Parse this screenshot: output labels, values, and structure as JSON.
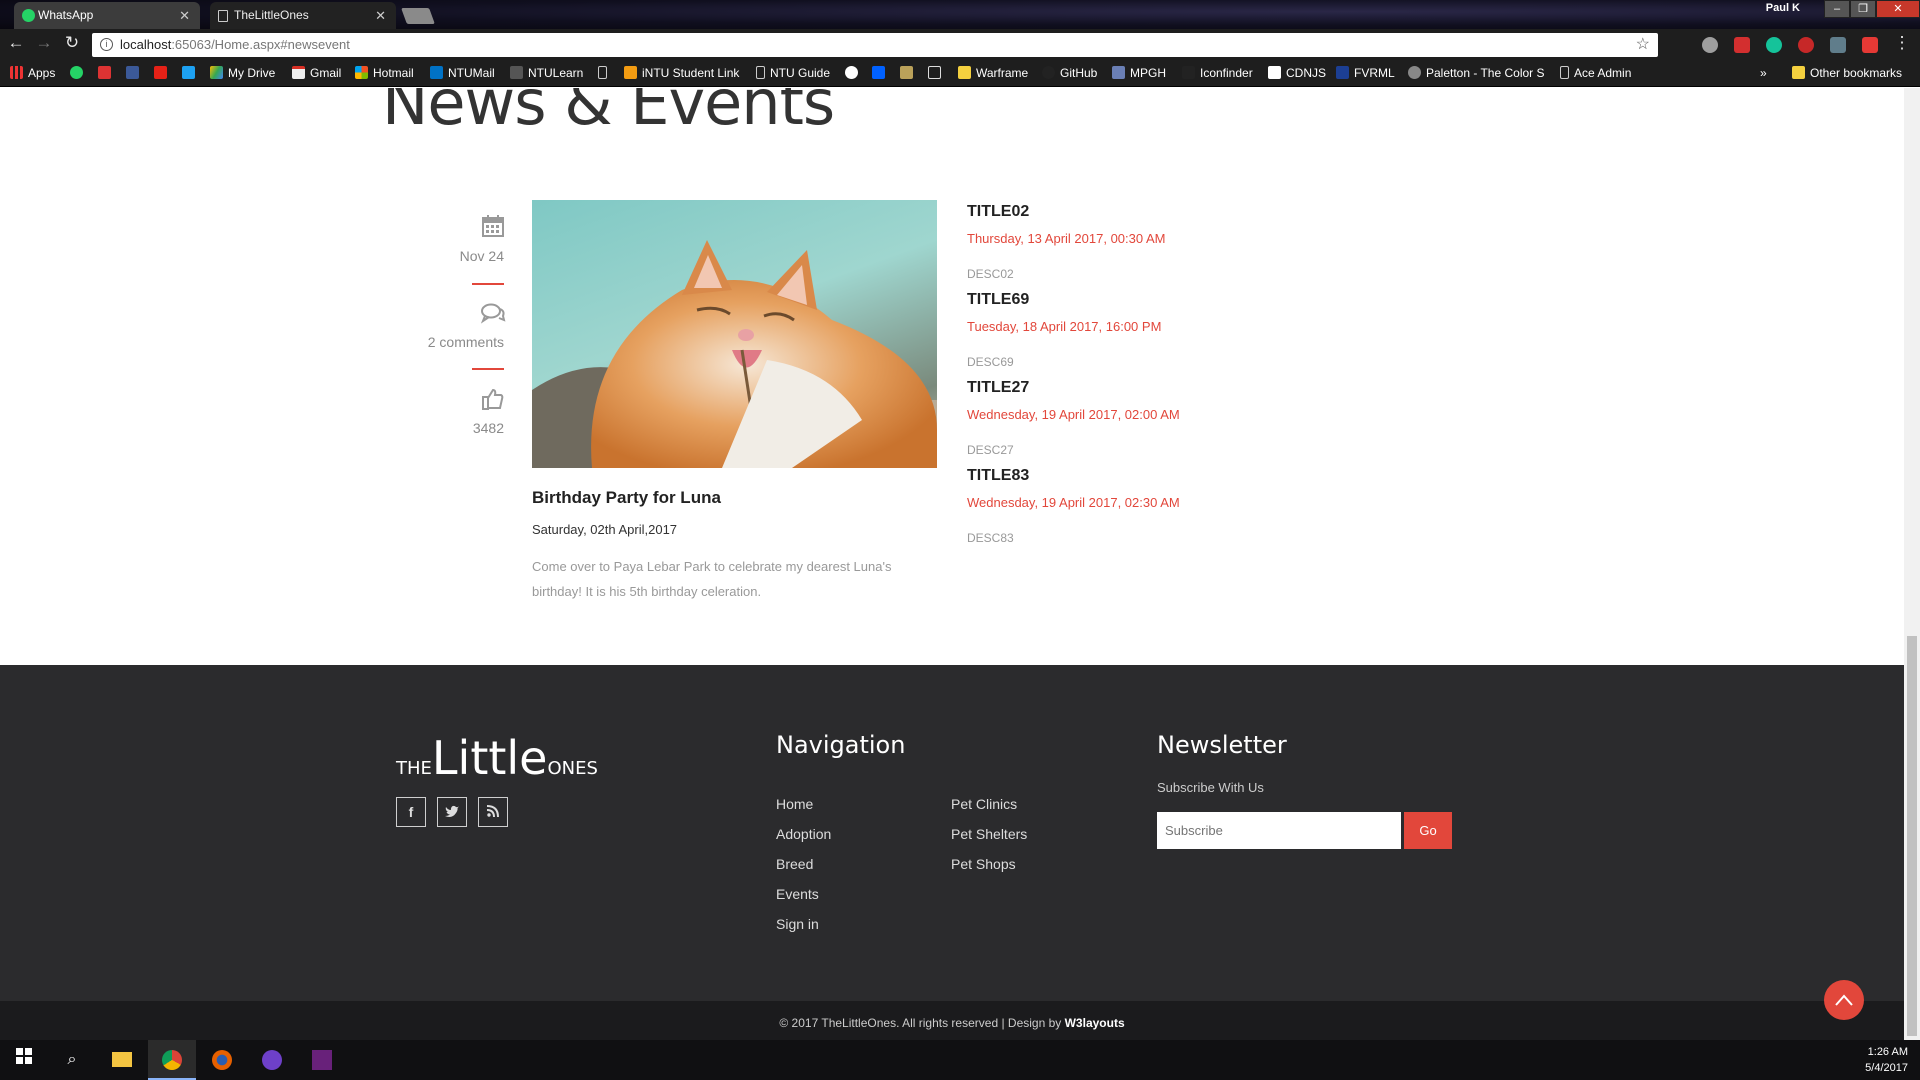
{
  "browser": {
    "tabs": [
      {
        "label": "WhatsApp"
      },
      {
        "label": "TheLittleOnes"
      }
    ],
    "profile_name": "Paul K",
    "url_host": "localhost",
    "url_path": ":65063/Home.aspx#newsevent",
    "bookmarks": [
      "Apps",
      "My Drive",
      "Gmail",
      "Hotmail",
      "NTUMail",
      "NTULearn",
      "iNTU Student Link",
      "NTU Guide",
      "Warframe",
      "GitHub",
      "MPGH",
      "Iconfinder",
      "CDNJS",
      "FVRML",
      "Paletton - The Color S",
      "Ace Admin",
      "Other bookmarks"
    ]
  },
  "page": {
    "heading": "News & Events",
    "meta": {
      "date": "Nov 24",
      "comments": "2 comments",
      "likes": "3482"
    },
    "post": {
      "title": "Birthday Party for Luna",
      "date": "Saturday, 02th April,2017",
      "description": "Come over to Paya Lebar Park to celebrate my dearest Luna's birthday! It is his 5th birthday celeration."
    },
    "events": [
      {
        "title": "TITLE02",
        "time": "Thursday, 13 April 2017, 00:30 AM",
        "desc": "DESC02"
      },
      {
        "title": "TITLE69",
        "time": "Tuesday, 18 April 2017, 16:00 PM",
        "desc": "DESC69"
      },
      {
        "title": "TITLE27",
        "time": "Wednesday, 19 April 2017, 02:00 AM",
        "desc": "DESC27"
      },
      {
        "title": "TITLE83",
        "time": "Wednesday, 19 April 2017, 02:30 AM",
        "desc": "DESC83"
      }
    ],
    "footer": {
      "logo_the": "THE",
      "logo_little": "Little",
      "logo_ones": "ONES",
      "navigation_heading": "Navigation",
      "nav_col1": [
        "Home",
        "Adoption",
        "Breed",
        "Events",
        "Sign in"
      ],
      "nav_col2": [
        "Pet Clinics",
        "Pet Shelters",
        "Pet Shops"
      ],
      "newsletter_heading": "Newsletter",
      "newsletter_sub": "Subscribe With Us",
      "subscribe_placeholder": "Subscribe",
      "go_label": "Go",
      "copyright": "© 2017 TheLittleOnes. All rights reserved | Design by",
      "designer": "W3layouts"
    }
  },
  "taskbar": {
    "time": "1:26 AM",
    "date": "5/4/2017"
  },
  "colors": {
    "accent": "#e2473b",
    "footer_bg": "#2b2b2d",
    "copyright_bg": "#1b1b1d"
  }
}
